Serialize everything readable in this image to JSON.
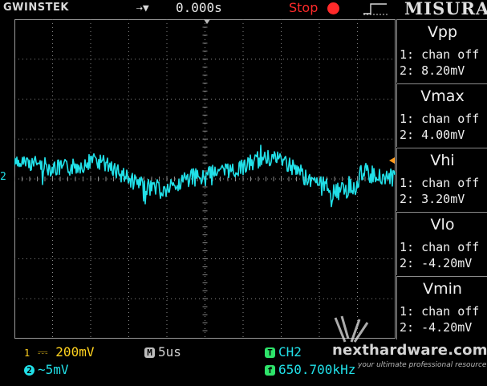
{
  "top": {
    "brand": "GWINSTEK",
    "trigger_arrow": "⇢▼",
    "trigger_time": "0.000s",
    "run_state": "Stop",
    "watermark": "MISURA"
  },
  "channel_marker": "2",
  "measurements": [
    {
      "name": "Vpp",
      "ch1": "1: chan off",
      "ch2": "2: 8.20mV"
    },
    {
      "name": "Vmax",
      "ch1": "1: chan off",
      "ch2": "2: 4.00mV"
    },
    {
      "name": "Vhi",
      "ch1": "1: chan off",
      "ch2": "2: 3.20mV"
    },
    {
      "name": "Vlo",
      "ch1": "1: chan off",
      "ch2": "2: -4.20mV"
    },
    {
      "name": "Vmin",
      "ch1": "1: chan off",
      "ch2": "2: -4.20mV"
    }
  ],
  "bottom": {
    "ch1_badge": "1",
    "ch1_coupling": "⎓",
    "ch1_scale": "200mV",
    "ch2_badge": "2",
    "ch2_coupling": "~",
    "ch2_scale": "5mV",
    "timebase_badge": "M",
    "timebase": "5us",
    "trigger_badge": "T",
    "trigger_source": "CH2",
    "freq_badge": "f",
    "frequency": "650.700kHz"
  },
  "logo": {
    "main": "nexthardware.com",
    "tagline": "your ultimate professional resource"
  },
  "colors": {
    "ch1": "#ffd21f",
    "ch2": "#21e0e8",
    "stop": "#ff2a2a",
    "grid": "#9a9a9a",
    "trigger_level": "#ff9a1a"
  },
  "icons": {
    "trigger_edge": "rising-edge-icon",
    "stop": "stop-dot-icon"
  }
}
